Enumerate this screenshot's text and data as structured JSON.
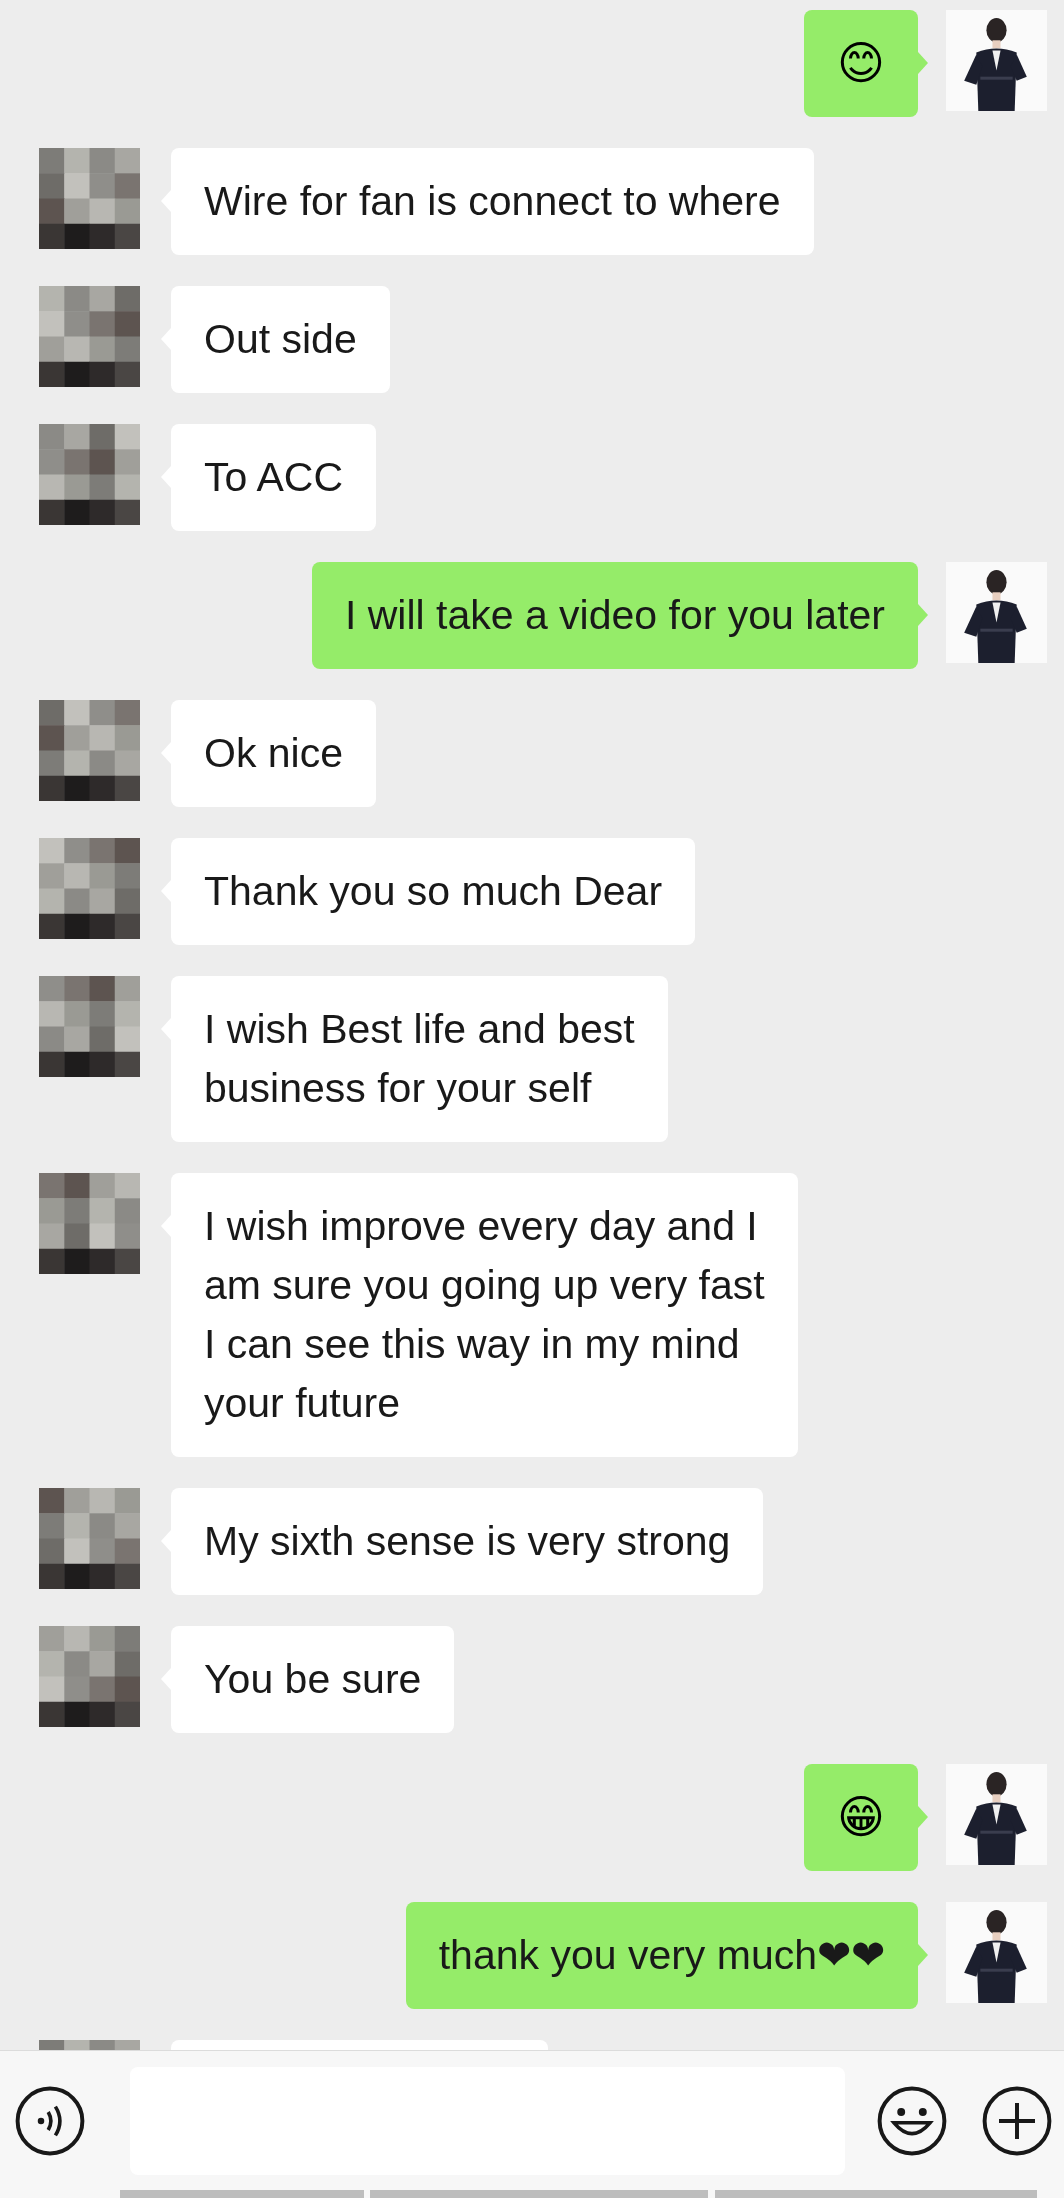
{
  "messages": [
    {
      "kind": "sent-emoji",
      "text": "😊"
    },
    {
      "kind": "received",
      "text": "Wire for fan is connect to where"
    },
    {
      "kind": "received",
      "text": "Out side"
    },
    {
      "kind": "received",
      "text": "To ACC"
    },
    {
      "kind": "sent",
      "text": "I will take a video for you later"
    },
    {
      "kind": "received",
      "text": "Ok nice"
    },
    {
      "kind": "received",
      "text": "Thank you so much Dear"
    },
    {
      "kind": "received",
      "text": "I wish Best life and best\nbusiness for your self"
    },
    {
      "kind": "received",
      "text": "I wish improve every day and I\nam sure you going up very fast\nI can see this way in my mind\nyour future"
    },
    {
      "kind": "received",
      "text": "My sixth sense is very strong"
    },
    {
      "kind": "received",
      "text": "You be sure"
    },
    {
      "kind": "sent-emoji",
      "text": "😁"
    },
    {
      "kind": "sent",
      "text": "thank you very much❤❤"
    },
    {
      "kind": "received-cut"
    }
  ]
}
